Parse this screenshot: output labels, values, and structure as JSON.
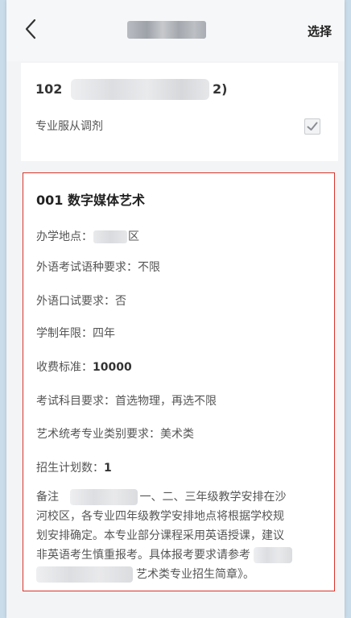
{
  "nav": {
    "back_icon": "chevron-left-icon",
    "action_label": "选择"
  },
  "school": {
    "code_prefix": "102",
    "code_suffix": "2)",
    "adjust_label": "专业服从调剂",
    "adjust_checked": true
  },
  "major": {
    "title": "001 数字媒体艺术",
    "location_label": "办学地点：",
    "location_suffix": "区",
    "language_req": "外语考试语种要求：不限",
    "oral_req": "外语口试要求：否",
    "years": "学制年限：四年",
    "fee_label": "收费标准：",
    "fee_value": "10000",
    "subject_req": "考试科目要求：首选物理，再选不限",
    "art_req": "艺术统考专业类别要求：美术类",
    "plan_label": "招生计划数：",
    "plan_value": "1",
    "notes": {
      "line1_prefix": "备注",
      "line1_suffix": "一、二、三年级教学安排在沙",
      "line2": "河校区，各专业四年级教学安排地点将根据学校规",
      "line3": "划安排确定。本专业部分课程采用英语授课，建议",
      "line4_prefix": "非英语考生慎重报考。具体报考要求请参考",
      "line5_suffix": "艺术类专业招生简章》。"
    }
  }
}
